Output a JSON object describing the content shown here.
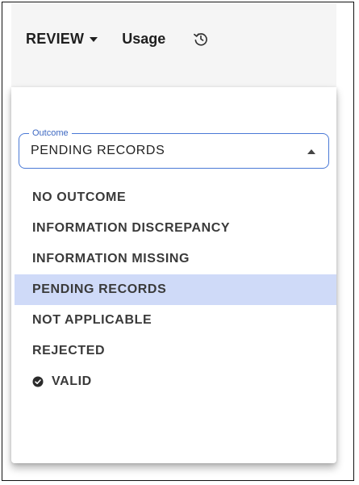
{
  "header": {
    "review_label": "REVIEW",
    "usage_label": "Usage",
    "history_icon": "history-icon"
  },
  "outcome_select": {
    "label": "Outcome",
    "value": "PENDING RECORDS",
    "accent_color": "#4a79d6"
  },
  "options": [
    {
      "label": "NO OUTCOME",
      "selected": false,
      "icon": ""
    },
    {
      "label": "INFORMATION DISCREPANCY",
      "selected": false,
      "icon": ""
    },
    {
      "label": "INFORMATION MISSING",
      "selected": false,
      "icon": ""
    },
    {
      "label": "PENDING RECORDS",
      "selected": true,
      "icon": ""
    },
    {
      "label": "NOT APPLICABLE",
      "selected": false,
      "icon": ""
    },
    {
      "label": "REJECTED",
      "selected": false,
      "icon": ""
    },
    {
      "label": "VALID",
      "selected": false,
      "icon": "check-circle-icon"
    }
  ],
  "colors": {
    "highlight": "#cfdaf8",
    "text": "#3a3a3a"
  }
}
